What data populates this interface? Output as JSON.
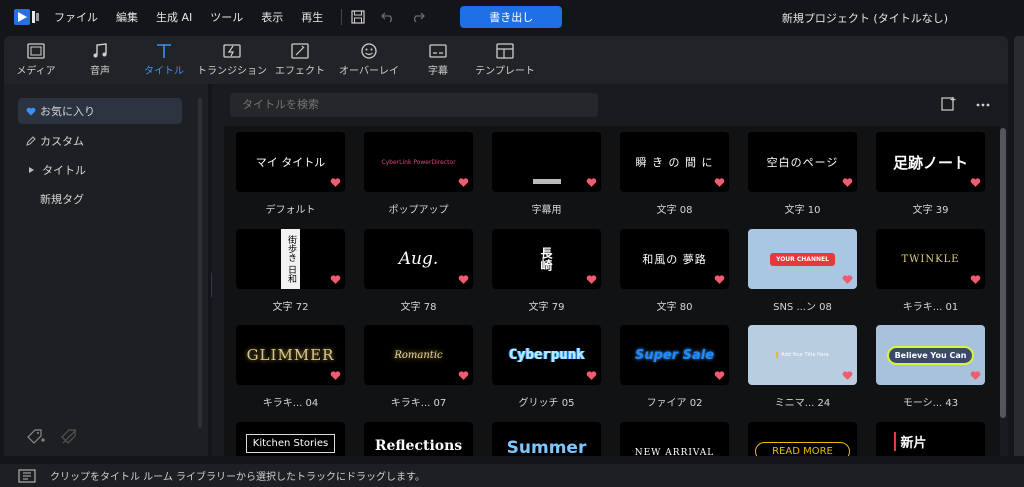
{
  "menu": [
    "ファイル",
    "編集",
    "生成 AI",
    "ツール",
    "表示",
    "再生"
  ],
  "export_label": "書き出し",
  "project_title": "新規プロジェクト (タイトルなし)",
  "tabs": [
    {
      "label": "メディア",
      "icon": "media-icon",
      "active": false
    },
    {
      "label": "音声",
      "icon": "music-note-icon",
      "active": false
    },
    {
      "label": "タイトル",
      "icon": "title-t-icon",
      "active": true
    },
    {
      "label": "トランジション",
      "icon": "transition-icon",
      "active": false
    },
    {
      "label": "エフェクト",
      "icon": "effect-icon",
      "active": false
    },
    {
      "label": "オーバーレイ",
      "icon": "overlay-icon",
      "active": false
    },
    {
      "label": "字幕",
      "icon": "subtitle-icon",
      "active": false
    },
    {
      "label": "テンプレート",
      "icon": "template-icon",
      "active": false
    }
  ],
  "sidebar": {
    "items": [
      {
        "label": "お気に入り",
        "icon": "heart-icon",
        "selected": true
      },
      {
        "label": "カスタム",
        "icon": "pencil-icon",
        "selected": false
      },
      {
        "label": "タイトル",
        "icon": "caret-right-icon",
        "selected": false
      },
      {
        "label": "新規タグ",
        "icon": "",
        "selected": false
      }
    ]
  },
  "search": {
    "placeholder": "タイトルを検索"
  },
  "tiles": [
    {
      "label": "デフォルト",
      "text": "マイ タイトル",
      "style": "plain",
      "bg": "#000000",
      "fg": "#ffffff"
    },
    {
      "label": "ポップアップ",
      "text": "CyberLink PowerDirector",
      "style": "small-pink",
      "bg": "#000000",
      "fg": "#e0457b"
    },
    {
      "label": "字幕用",
      "text": "",
      "style": "subtitle-bar",
      "bg": "#000000",
      "fg": "#ffffff"
    },
    {
      "label": "文字 08",
      "text": "瞬 き の 間 に",
      "style": "jp-serif",
      "bg": "#000000",
      "fg": "#ffffff"
    },
    {
      "label": "文字 10",
      "text": "空白のページ",
      "style": "jp-serif",
      "bg": "#000000",
      "fg": "#ffffff"
    },
    {
      "label": "文字 39",
      "text": "足跡ノート",
      "style": "jp-bold",
      "bg": "#000000",
      "fg": "#ffffff"
    },
    {
      "label": "文字 72",
      "text": "街歩き 日和",
      "style": "jp-box",
      "bg": "#000000",
      "fg": "#000000"
    },
    {
      "label": "文字 78",
      "text": "Aug.",
      "style": "script",
      "bg": "#000000",
      "fg": "#ffffff"
    },
    {
      "label": "文字 79",
      "text": "長崎",
      "style": "jp-vertical",
      "bg": "#000000",
      "fg": "#ffffff"
    },
    {
      "label": "文字 80",
      "text": "和風の 夢路",
      "style": "jp-serif",
      "bg": "#000000",
      "fg": "#ffffff"
    },
    {
      "label": "SNS ...ン 08",
      "text": "YOUR CHANNEL",
      "style": "sns",
      "bg": "#a9c7e3",
      "fg": "#ffffff"
    },
    {
      "label": "キラキ... 01",
      "text": "TWINKLE",
      "style": "gold-serif",
      "bg": "#000000",
      "fg": "#e3cf7a"
    },
    {
      "label": "キラキ... 04",
      "text": "GLIMMER",
      "style": "gold-glitter",
      "bg": "#000000",
      "fg": "#d8c68a"
    },
    {
      "label": "キラキ... 07",
      "text": "Romantic",
      "style": "gold-heart",
      "bg": "#000000",
      "fg": "#e8d89a"
    },
    {
      "label": "グリッチ 05",
      "text": "Cyberpunk",
      "style": "glitch",
      "bg": "#000000",
      "fg": "#bfe8ff"
    },
    {
      "label": "ファイア 02",
      "text": "Super Sale",
      "style": "fire",
      "bg": "#000000",
      "fg": "#1f8bff"
    },
    {
      "label": "ミニマ... 24",
      "text": "Add Your Title Here",
      "style": "minimal",
      "bg": "#b9cde0",
      "fg": "#ffffff"
    },
    {
      "label": "モーシ... 43",
      "text": "Believe You Can",
      "style": "motion",
      "bg": "#a8c2dc",
      "fg": "#ffffff"
    },
    {
      "label": "",
      "text": "Kitchen Stories",
      "style": "boxed",
      "bg": "#000000",
      "fg": "#ffffff"
    },
    {
      "label": "",
      "text": "Reflections",
      "style": "bold-serif",
      "bg": "#000000",
      "fg": "#ffffff"
    },
    {
      "label": "",
      "text": "Summer",
      "style": "summer",
      "bg": "#000000",
      "fg": "#7fc8ff"
    },
    {
      "label": "",
      "text": "NEW ARRIVAL",
      "style": "arrival",
      "bg": "#000000",
      "fg": "#ffffff"
    },
    {
      "label": "",
      "text": "READ MORE",
      "style": "readmore",
      "bg": "#000000",
      "fg": "#e6c200"
    },
    {
      "label": "",
      "text": "新片",
      "style": "jp-red",
      "bg": "#000000",
      "fg": "#ffffff"
    }
  ],
  "status": {
    "text": "クリップをタイトル ルーム ライブラリーから選択したトラックにドラッグします。"
  },
  "colors": {
    "accent": "#1f6fe6",
    "active_tab": "#3d8ff0",
    "heart": "#f05b6e"
  }
}
